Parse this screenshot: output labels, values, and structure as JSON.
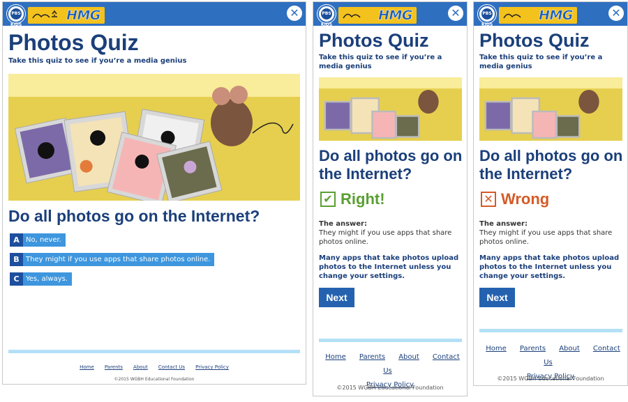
{
  "brand": {
    "pbs": "PBS KIDS",
    "logo": "HMG",
    "close": "✕"
  },
  "quiz": {
    "title": "Photos Quiz",
    "subtitle": "Take this quiz to see if you’re a media genius",
    "question": "Do all photos go on the Internet?",
    "options": [
      {
        "letter": "A",
        "text": "No, never."
      },
      {
        "letter": "B",
        "text": "They might if you use apps that share photos online."
      },
      {
        "letter": "C",
        "text": "Yes, always."
      }
    ]
  },
  "feedback": {
    "right": {
      "label": "Right!",
      "icon": "✔",
      "color": "#5a9f33"
    },
    "wrong": {
      "label": "Wrong",
      "icon": "✕",
      "color": "#d45b27"
    },
    "answer_label": "The answer:",
    "answer_text": "They might if you use apps that share photos online.",
    "explanation": "Many apps that take photos upload photos to the Internet unless you change your settings.",
    "next": "Next"
  },
  "footer": {
    "links": [
      "Home",
      "Parents",
      "About",
      "Contact Us",
      "Privacy Policy"
    ],
    "copyright": "©2015 WGBH Educational Foundation"
  },
  "colors": {
    "header": "#2e6fc0",
    "title": "#1b3f7a",
    "answer_letter": "#1d4f9e",
    "answer_bg": "#3d96de",
    "footer_rule": "#b3e0f6"
  }
}
